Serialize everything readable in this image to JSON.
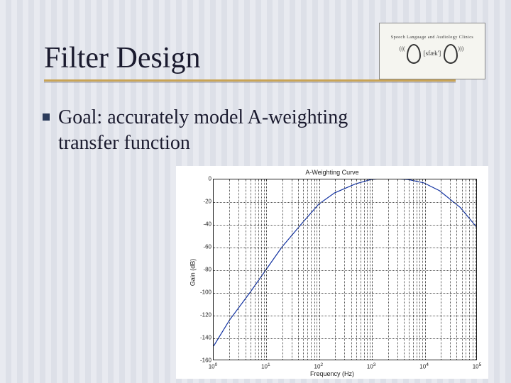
{
  "title": "Filter Design",
  "bullet_text_line1": "Goal: accurately model A-weighting",
  "bullet_text_line2": "transfer function",
  "logo": {
    "top_text": "Speech Language and Audiology Clinics",
    "ipa": "[sfæk']"
  },
  "chart_data": {
    "type": "line",
    "title": "A-Weighting Curve",
    "xlabel": "Frequency (Hz)",
    "ylabel": "Gain (dB)",
    "x_log": true,
    "xlim": [
      1,
      100000
    ],
    "ylim": [
      -160,
      0
    ],
    "xticks": [
      1,
      10,
      100,
      1000,
      10000,
      100000
    ],
    "xtick_labels": [
      "10^0",
      "10^1",
      "10^2",
      "10^3",
      "10^4",
      "10^5"
    ],
    "yticks": [
      0,
      -20,
      -40,
      -60,
      -80,
      -100,
      -120,
      -140,
      -160
    ],
    "x": [
      1,
      2,
      5,
      10,
      20,
      50,
      100,
      200,
      500,
      1000,
      2000,
      5000,
      10000,
      20000,
      50000,
      100000
    ],
    "y": [
      -148,
      -125,
      -100,
      -80,
      -60,
      -38,
      -22,
      -12,
      -4,
      0,
      1,
      0,
      -3,
      -10,
      -25,
      -42
    ]
  }
}
